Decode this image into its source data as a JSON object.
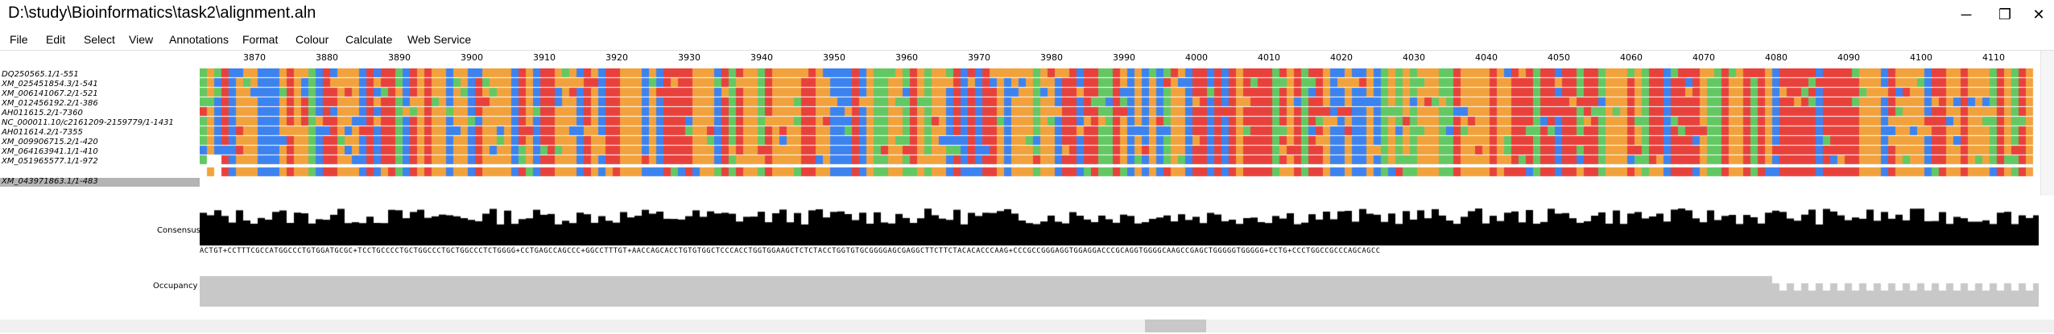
{
  "window": {
    "title": "D:\\study\\Bioinformatics\\task2\\alignment.aln",
    "minimize": "─",
    "restore": "❐",
    "close": "✕"
  },
  "menu": [
    "File",
    "Edit",
    "Select",
    "View",
    "Annotations",
    "Format",
    "Colour",
    "Calculate",
    "Web Service"
  ],
  "ruler": {
    "labels": [
      "3870",
      "3880",
      "3890",
      "3900",
      "3910",
      "3920",
      "3930",
      "3940",
      "3950",
      "3960",
      "3970",
      "3980",
      "3990",
      "4000",
      "4010",
      "4020",
      "4030",
      "4040",
      "4050",
      "4060",
      "4070",
      "4080",
      "4090",
      "4100",
      "4110"
    ]
  },
  "sequences": [
    "DQ250565.1/1-551",
    "XM_025451854.3/1-541",
    "XM_006141067.2/1-521",
    "XM_012456192.2/1-386",
    "AH011615.2/1-7360",
    "NC_000011.10/c2161209-2159779/1-1431",
    "AH011614.2/1-7355",
    "XM_009906715.2/1-420",
    "XM_064163941.1/1-410",
    "XM_051965577.1/1-972",
    "XM_043971863.1/1-483"
  ],
  "selected_row": "XM_043971863.1/1-483",
  "annotations": {
    "consensus_label": "Consensus",
    "occupancy_label": "Occupancy"
  },
  "consensus_sequence": "ACTGT+CCTTTCGCCATGGCCCTGTGGATGCGC+TCCTGCCCCTGCTGGCCCTGCTGGCCCTCTGGGG+CCTGAGCCAGCCC+GGCCTTTGT+AACCAGCACCTGTGTGGCTCCCACCTGGTGGAAGCTCTCTACCTGGTGTGCGGGGAGCGAGGCTTCTTCTACACACCCAAG+CCCGCCGGGAGGTGGAGGACCCGCAGGTGGGGCAAGCCGAGCTGGGGGTGGGGG+CCTG+CCCTGGCCGCCCAGCAGCC",
  "colors": {
    "A": "#63c863",
    "C": "#f2a23c",
    "G": "#e8413c",
    "T": "#3c83f0",
    "gap": "#ffffff",
    "consensus_bar": "#000000",
    "occupancy_bar": "#c8c8c8"
  }
}
